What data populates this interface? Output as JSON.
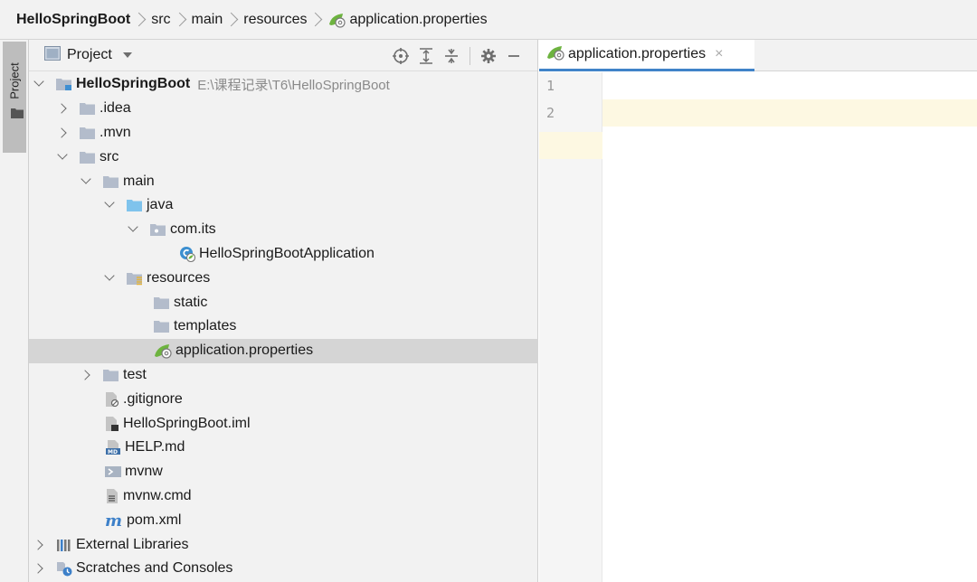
{
  "breadcrumb": {
    "items": [
      "HelloSpringBoot",
      "src",
      "main",
      "resources",
      "application.properties"
    ]
  },
  "tool_strip": {
    "tab_label": "Project"
  },
  "panel": {
    "title": "Project",
    "tools": [
      "locate-icon",
      "expand-all-icon",
      "collapse-all-icon",
      "settings-gear-icon",
      "hide-icon"
    ]
  },
  "tree": [
    {
      "label": "HelloSpringBoot",
      "hint": "E:\\课程记录\\T6\\HelloSpringBoot",
      "arrow": "down",
      "icon": "module-folder-icon"
    },
    {
      "label": ".idea",
      "arrow": "right",
      "icon": "folder-icon"
    },
    {
      "label": ".mvn",
      "arrow": "right",
      "icon": "folder-icon"
    },
    {
      "label": "src",
      "arrow": "down",
      "icon": "folder-icon"
    },
    {
      "label": "main",
      "arrow": "down",
      "icon": "folder-icon"
    },
    {
      "label": "java",
      "arrow": "down",
      "icon": "source-folder-icon"
    },
    {
      "label": "com.its",
      "arrow": "down",
      "icon": "package-icon"
    },
    {
      "label": "HelloSpringBootApplication",
      "arrow": "none",
      "icon": "spring-class-icon"
    },
    {
      "label": "resources",
      "arrow": "down",
      "icon": "resources-folder-icon"
    },
    {
      "label": "static",
      "arrow": "none",
      "icon": "folder-icon"
    },
    {
      "label": "templates",
      "arrow": "none",
      "icon": "folder-icon"
    },
    {
      "label": "application.properties",
      "arrow": "none",
      "icon": "spring-properties-icon",
      "selected": true
    },
    {
      "label": "test",
      "arrow": "right",
      "icon": "folder-icon"
    },
    {
      "label": ".gitignore",
      "arrow": "none",
      "icon": "ignore-file-icon"
    },
    {
      "label": "HelloSpringBoot.iml",
      "arrow": "none",
      "icon": "iml-file-icon"
    },
    {
      "label": "HELP.md",
      "arrow": "none",
      "icon": "markdown-file-icon"
    },
    {
      "label": "mvnw",
      "arrow": "none",
      "icon": "shell-file-icon"
    },
    {
      "label": "mvnw.cmd",
      "arrow": "none",
      "icon": "text-file-icon"
    },
    {
      "label": "pom.xml",
      "arrow": "none",
      "icon": "maven-icon"
    },
    {
      "label": "External Libraries",
      "arrow": "right",
      "icon": "libraries-icon"
    },
    {
      "label": "Scratches and Consoles",
      "arrow": "right",
      "icon": "scratches-icon"
    }
  ],
  "editor": {
    "tab_label": "application.properties",
    "tab_close": "×",
    "lines": [
      "1",
      "2"
    ]
  },
  "colors": {
    "accent": "#4083c9",
    "selection": "#d5d5d5",
    "current_line": "#fdf8e2",
    "folder": "#b3bccb",
    "spring_green": "#6db33f"
  }
}
